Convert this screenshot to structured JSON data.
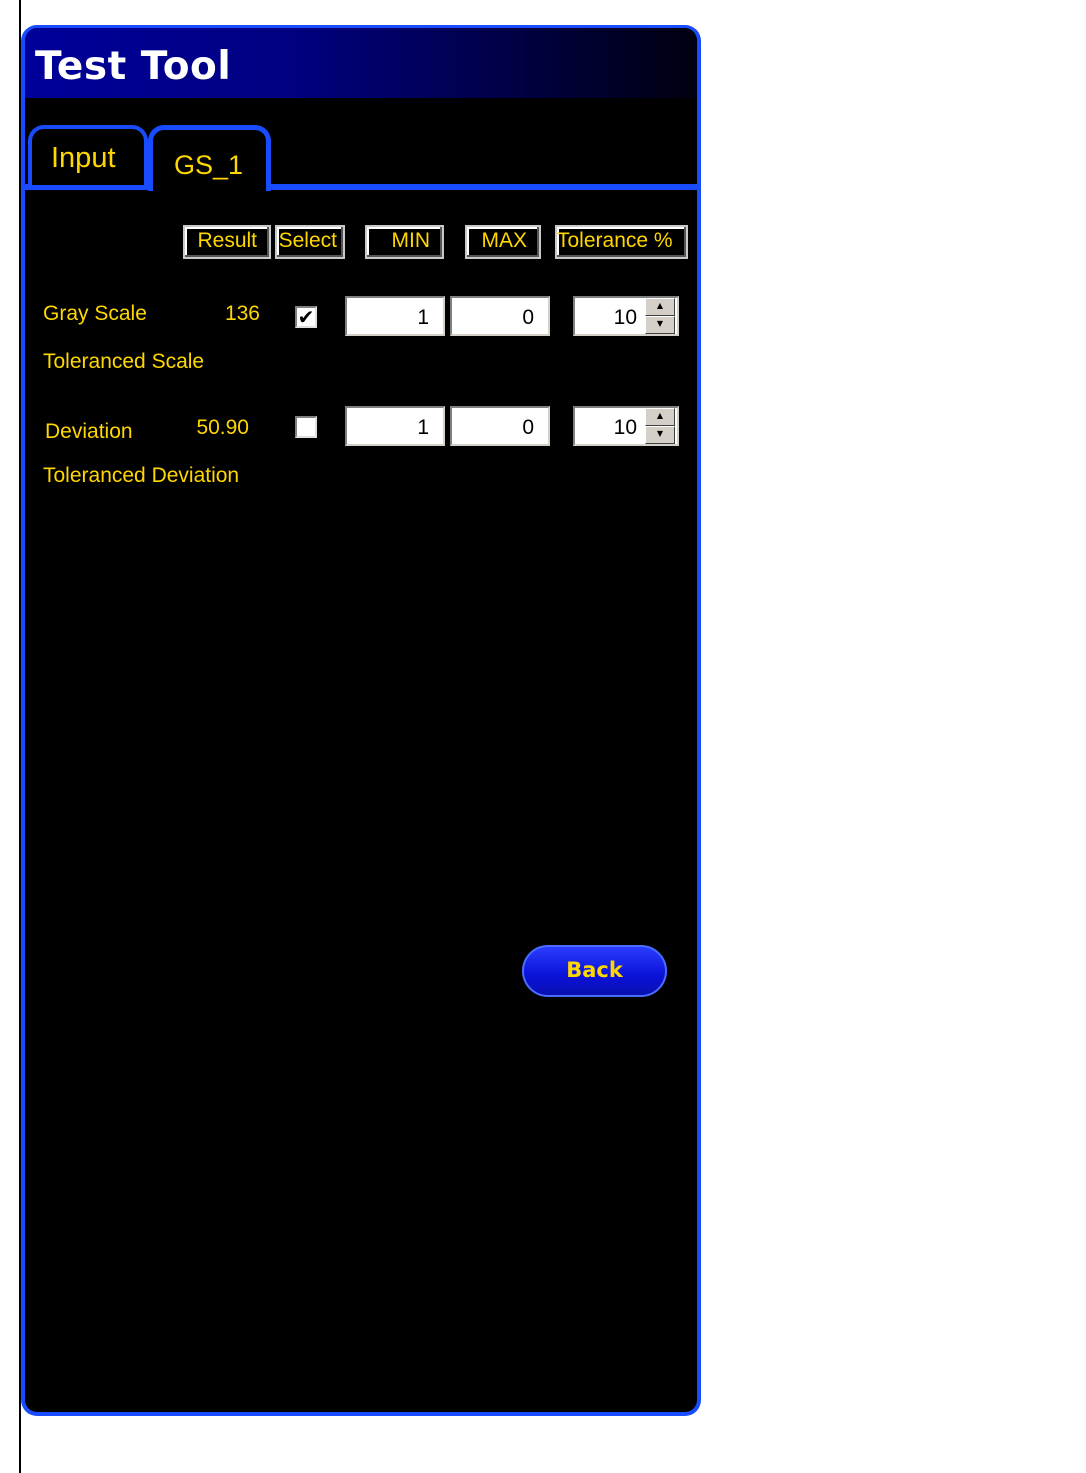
{
  "window": {
    "title": "Test Tool"
  },
  "tabs": [
    {
      "label": "Input",
      "selected": false
    },
    {
      "label": "GS_1",
      "selected": true
    }
  ],
  "columns": {
    "result": "Result",
    "select": "Select",
    "min": "MIN",
    "max": "MAX",
    "tolerance": "Tolerance %"
  },
  "rows": [
    {
      "label": "Gray Scale",
      "result": "136",
      "selected": true,
      "min": "1",
      "max": "0",
      "tolerance": "10",
      "sublabel": "Toleranced Scale"
    },
    {
      "label": "Deviation",
      "result": "50.90",
      "selected": false,
      "min": "1",
      "max": "0",
      "tolerance": "10",
      "sublabel": "Toleranced Deviation"
    }
  ],
  "buttons": {
    "back": "Back"
  },
  "colors": {
    "frame": "#1a4cff",
    "text": "#ffd700",
    "background": "#000000"
  },
  "icons": {
    "checkmark": "check-icon",
    "spin_up": "arrow-up-icon",
    "spin_down": "arrow-down-icon"
  }
}
